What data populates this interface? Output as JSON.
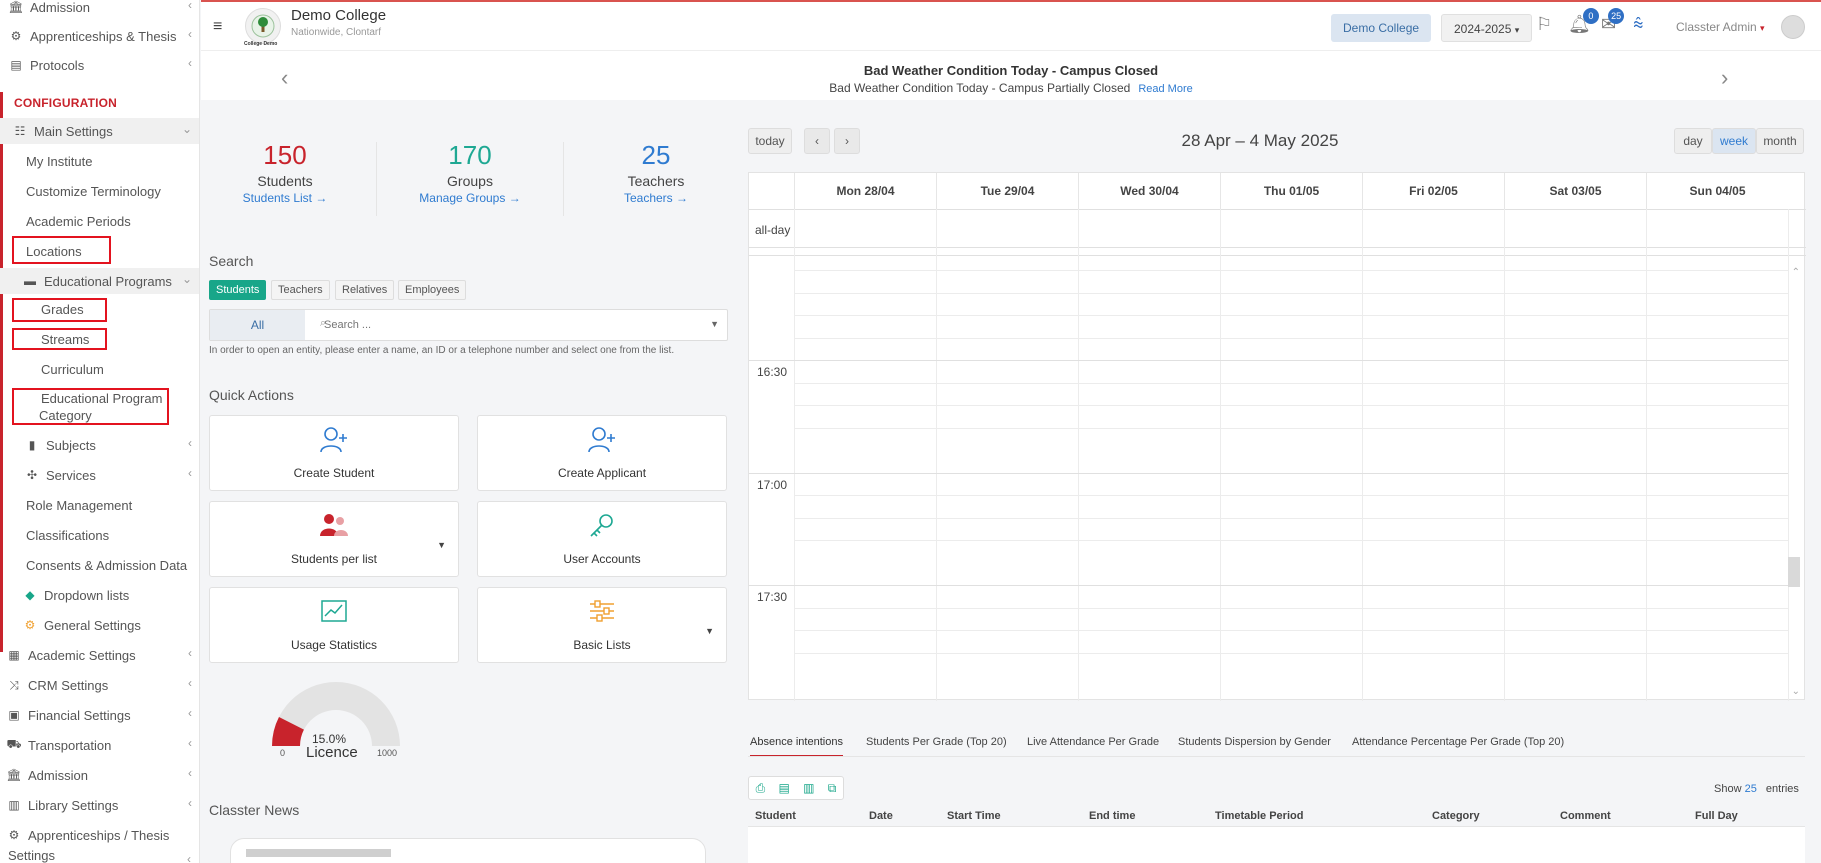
{
  "sidebar": {
    "items_top": [
      {
        "label": "Admission",
        "icon": "bank-icon"
      },
      {
        "label": "Apprenticeships & Thesis",
        "icon": "gear-icon"
      },
      {
        "label": "Protocols",
        "icon": "protocol-icon"
      }
    ],
    "config_heading": "CONFIGURATION",
    "main_settings": "Main Settings",
    "main_items": [
      "My Institute",
      "Customize Terminology",
      "Academic Periods",
      "Locations"
    ],
    "edu_programs": "Educational Programs",
    "edu_items": [
      "Grades",
      "Streams",
      "Curriculum"
    ],
    "edu_category_line1": "Educational Program",
    "edu_category_line2": "Category",
    "more_items": [
      "Subjects",
      "Services",
      "Role Management",
      "Classifications",
      "Consents & Admission Data",
      "Dropdown lists",
      "General Settings"
    ],
    "bottom_items": [
      {
        "label": "Academic Settings",
        "icon": "calendar-grid-icon"
      },
      {
        "label": "CRM Settings",
        "icon": "shuffle-icon"
      },
      {
        "label": "Financial Settings",
        "icon": "money-icon"
      },
      {
        "label": "Transportation",
        "icon": "bus-icon"
      },
      {
        "label": "Admission",
        "icon": "bank-icon"
      },
      {
        "label": "Library Settings",
        "icon": "books-icon"
      },
      {
        "label": "Apprenticeships / Thesis",
        "icon": "gear-icon"
      }
    ],
    "cut_text": "Settings"
  },
  "header": {
    "college_name": "Demo College",
    "college_location": "Nationwide, Clontarf",
    "logo_caption": "College Demo",
    "college_button": "Demo College",
    "year_select": "2024-2025",
    "notifications_count": "0",
    "messages_count": "25",
    "user_name": "Classter Admin"
  },
  "announcement": {
    "title": "Bad Weather Condition Today - Campus Closed",
    "text": "Bad Weather Condition Today - Campus Partially Closed",
    "read_more": "Read More"
  },
  "stats": [
    {
      "num": "150",
      "label": "Students",
      "link": "Students List",
      "color": "#c8232c"
    },
    {
      "num": "170",
      "label": "Groups",
      "link": "Manage Groups",
      "color": "#1ea893"
    },
    {
      "num": "25",
      "label": "Teachers",
      "link": "Teachers",
      "color": "#2f7bd0"
    }
  ],
  "search": {
    "title": "Search",
    "tabs": [
      "Students",
      "Teachers",
      "Relatives",
      "Employees"
    ],
    "scope": "All",
    "placeholder": "Search ...",
    "hint": "In order to open an entity, please enter a name, an ID or a telephone number and select one from the list."
  },
  "quick_actions": {
    "title": "Quick Actions",
    "items": [
      "Create Student",
      "Create Applicant",
      "Students per list",
      "User Accounts",
      "Usage Statistics",
      "Basic Lists"
    ]
  },
  "licence": {
    "percent": "15.0%",
    "label": "Licence",
    "min": "0",
    "max": "1000",
    "value_fraction": 0.15
  },
  "news": {
    "title": "Classter News"
  },
  "calendar": {
    "today": "today",
    "prev": "‹",
    "next": "›",
    "range": "28 Apr – 4 May 2025",
    "views": [
      "day",
      "week",
      "month"
    ],
    "days": [
      "Mon 28/04",
      "Tue 29/04",
      "Wed 30/04",
      "Thu 01/05",
      "Fri 02/05",
      "Sat 03/05",
      "Sun 04/05"
    ],
    "all_day": "all-day",
    "times": [
      "16:30",
      "17:00",
      "17:30"
    ]
  },
  "bottom_tabs": [
    "Absence intentions",
    "Students Per Grade (Top 20)",
    "Live Attendance Per Grade",
    "Students Dispersion by Gender",
    "Attendance Percentage Per Grade (Top 20)"
  ],
  "table": {
    "columns": [
      "Student",
      "Date",
      "Start Time",
      "End time",
      "Timetable Period",
      "Category",
      "Comment",
      "Full Day"
    ],
    "show_label": "Show",
    "show_value": "25",
    "entries_label": "entries"
  },
  "colors": {
    "accent_red": "#c8232c",
    "accent_teal": "#1ea893",
    "accent_blue": "#2f7bd0",
    "highlight_red": "#e3131f"
  }
}
